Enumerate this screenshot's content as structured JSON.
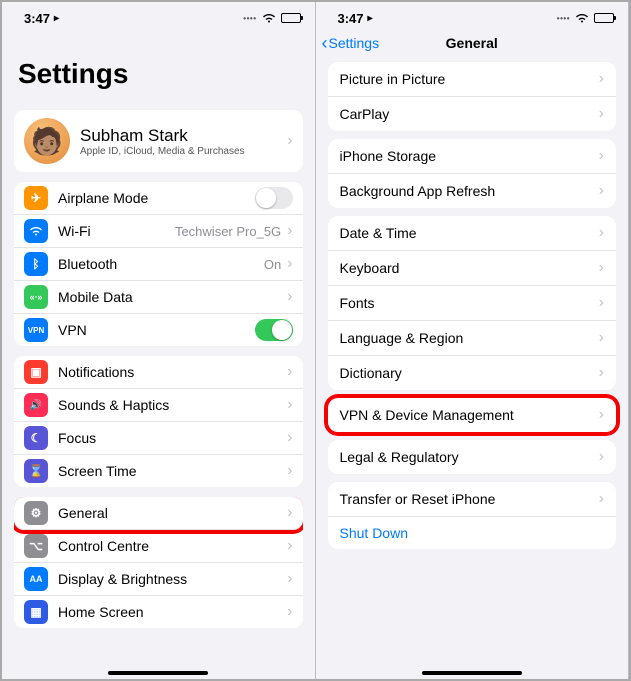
{
  "status": {
    "time": "3:47",
    "loc_glyph": "⎋"
  },
  "left": {
    "title": "Settings",
    "profile": {
      "name": "Subham  Stark",
      "sub": "Apple ID, iCloud, Media & Purchases"
    },
    "network": {
      "airplane": {
        "label": "Airplane Mode",
        "on": false,
        "icon_bg": "#ff9500",
        "glyph": "✈"
      },
      "wifi": {
        "label": "Wi-Fi",
        "detail": "Techwiser Pro_5G",
        "icon_bg": "#007aff",
        "glyph": "ᯤ"
      },
      "bluetooth": {
        "label": "Bluetooth",
        "detail": "On",
        "icon_bg": "#007aff",
        "glyph": "ᛒ"
      },
      "mobile": {
        "label": "Mobile Data",
        "icon_bg": "#34c759",
        "glyph": "▮"
      },
      "vpn": {
        "label": "VPN",
        "on": true,
        "icon_bg": "#007aff",
        "glyph": "VPN"
      }
    },
    "system1": {
      "notifications": {
        "label": "Notifications",
        "icon_bg": "#ff3b30",
        "glyph": "▣"
      },
      "sounds": {
        "label": "Sounds & Haptics",
        "icon_bg": "#ff2d55",
        "glyph": "🔊"
      },
      "focus": {
        "label": "Focus",
        "icon_bg": "#5856d6",
        "glyph": "☾"
      },
      "screentime": {
        "label": "Screen Time",
        "icon_bg": "#5856d6",
        "glyph": "⌛"
      }
    },
    "system2": {
      "general": {
        "label": "General",
        "icon_bg": "#8e8e93",
        "glyph": "⚙"
      },
      "control": {
        "label": "Control Centre",
        "icon_bg": "#8e8e93",
        "glyph": "⌥"
      },
      "display": {
        "label": "Display & Brightness",
        "icon_bg": "#007aff",
        "glyph": "AA"
      },
      "home": {
        "label": "Home Screen",
        "icon_bg": "#2d5be3",
        "glyph": "▦"
      }
    }
  },
  "right": {
    "back": "Settings",
    "title": "General",
    "g1": {
      "pip": "Picture in Picture",
      "carplay": "CarPlay"
    },
    "g2": {
      "storage": "iPhone Storage",
      "refresh": "Background App Refresh"
    },
    "g3": {
      "date": "Date & Time",
      "keyboard": "Keyboard",
      "fonts": "Fonts",
      "lang": "Language & Region",
      "dict": "Dictionary"
    },
    "g4": {
      "vpn": "VPN & Device Management"
    },
    "g5": {
      "legal": "Legal & Regulatory"
    },
    "g6": {
      "transfer": "Transfer or Reset iPhone",
      "shutdown": "Shut Down"
    }
  }
}
